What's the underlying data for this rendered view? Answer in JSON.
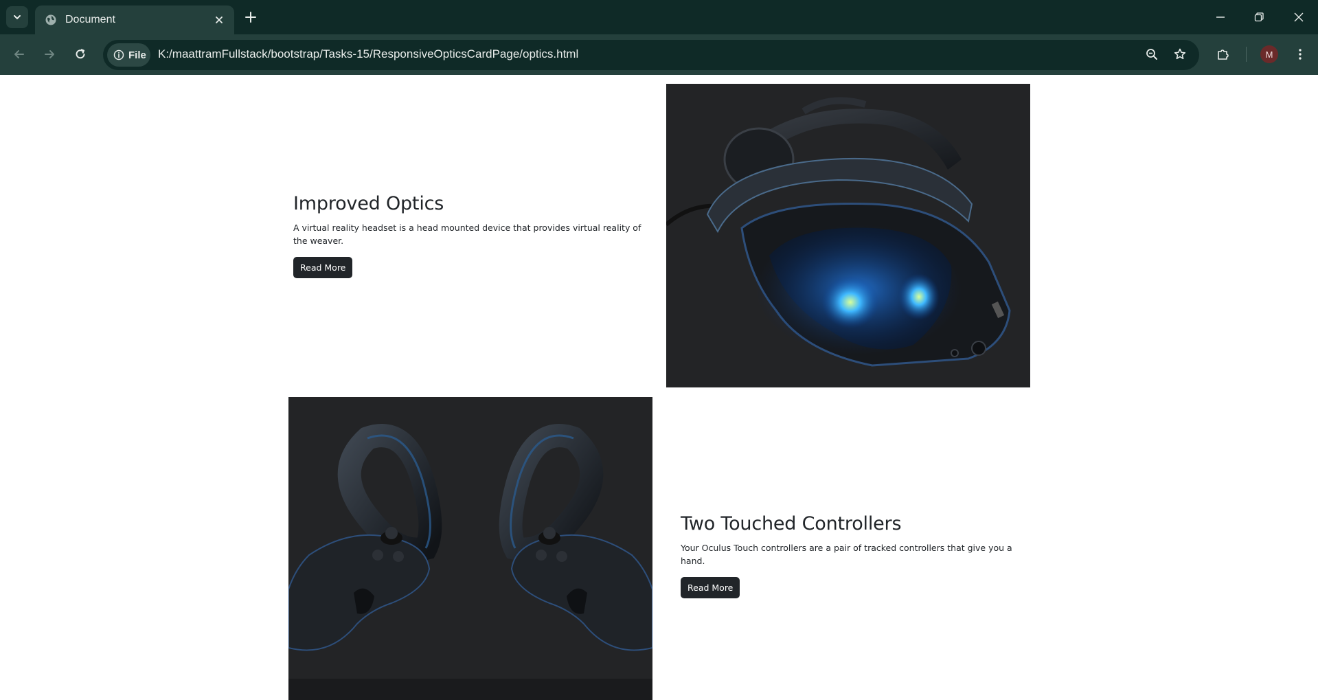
{
  "browser": {
    "tab_title": "Document",
    "chip_label": "File",
    "url": "K:/maattramFullstack/bootstrap/Tasks-15/ResponsiveOpticsCardPage/optics.html",
    "profile_initial": "M"
  },
  "cards": [
    {
      "title": "Improved Optics",
      "description": "A virtual reality headset is a head mounted device that provides virtual reality of the weaver.",
      "button": "Read More",
      "image": "vr-headset-image"
    },
    {
      "title": "Two Touched Controllers",
      "description": "Your Oculus Touch controllers are a pair of tracked controllers that give you a hand.",
      "button": "Read More",
      "image": "vr-controllers-image"
    }
  ],
  "colors": {
    "titlebar": "#0f2a27",
    "toolbar": "#24403c",
    "button_bg": "#212529",
    "image_bg": "#232426"
  }
}
